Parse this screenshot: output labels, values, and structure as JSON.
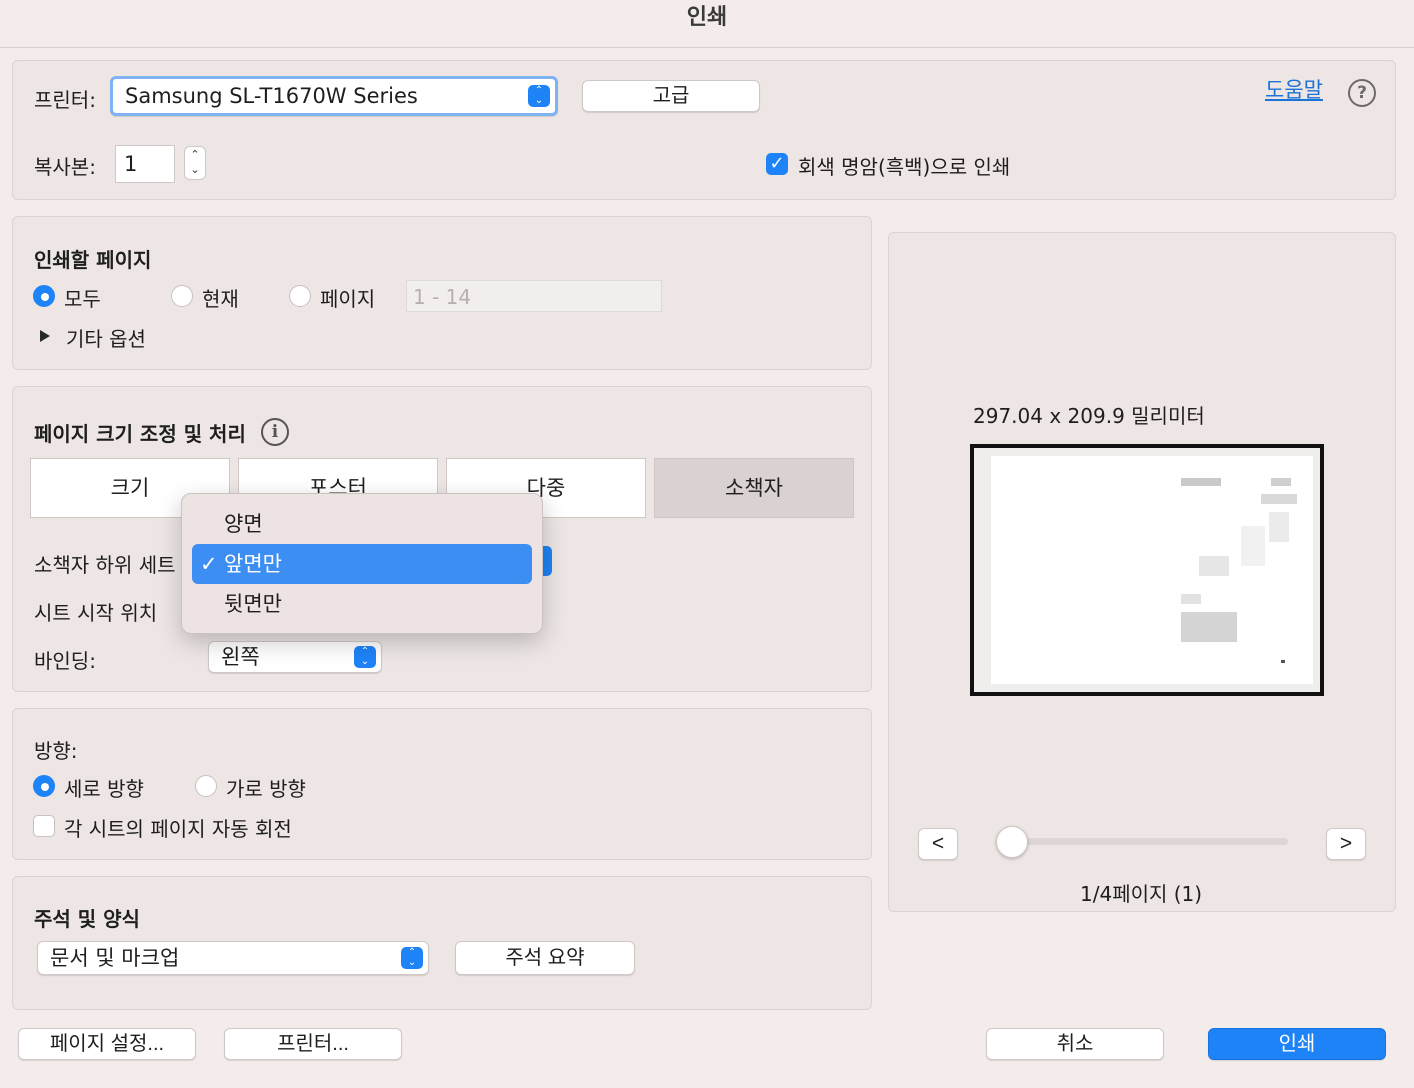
{
  "window": {
    "title": "인쇄"
  },
  "printer": {
    "label": "프린터:",
    "selected": "Samsung SL-T1670W Series",
    "advanced_button": "고급",
    "help_link": "도움말",
    "help_icon": "question-circle-icon"
  },
  "copies": {
    "label": "복사본:",
    "value": "1"
  },
  "grayscale": {
    "label": "회색 명암(흑백)으로 인쇄",
    "checked": true
  },
  "pages": {
    "heading": "인쇄할 페이지",
    "options": [
      "모두",
      "현재",
      "페이지"
    ],
    "selected": "모두",
    "range_placeholder": "1 - 14",
    "more_options": "기타 옵션"
  },
  "scaling": {
    "heading": "페이지 크기 조정 및 처리",
    "info_icon": "info-circle-icon",
    "tabs": [
      "크기",
      "포스터",
      "다중",
      "소책자"
    ],
    "active_tab": "소책자",
    "subset_label": "소책자 하위 세트",
    "sheet_start_label": "시트 시작 위치",
    "binding_label": "바인딩:",
    "binding_value": "왼쪽"
  },
  "subset_menu": {
    "items": [
      "양면",
      "앞면만",
      "뒷면만"
    ],
    "selected": "앞면만",
    "check_glyph": "✓"
  },
  "orientation": {
    "heading": "방향:",
    "options": [
      "세로 방향",
      "가로 방향"
    ],
    "selected": "세로 방향",
    "auto_rotate": "각 시트의 페이지 자동 회전",
    "auto_rotate_checked": false
  },
  "annotations": {
    "heading": "주석 및 양식",
    "selected": "문서 및 마크업",
    "summary_button": "주석 요약"
  },
  "preview": {
    "size_text": "297.04 x 209.9 밀리미터",
    "prev_button": "<",
    "next_button": ">",
    "page_status": "1/4페이지 (1)",
    "slider_position": 0
  },
  "footer": {
    "page_setup": "페이지 설정...",
    "printer_button": "프린터...",
    "cancel": "취소",
    "print": "인쇄"
  },
  "colors": {
    "accent": "#1e83f7",
    "menu_highlight": "#3d8ef2",
    "background": "#f4ecea",
    "panel": "#ede6e4",
    "link": "#1a73d8"
  }
}
